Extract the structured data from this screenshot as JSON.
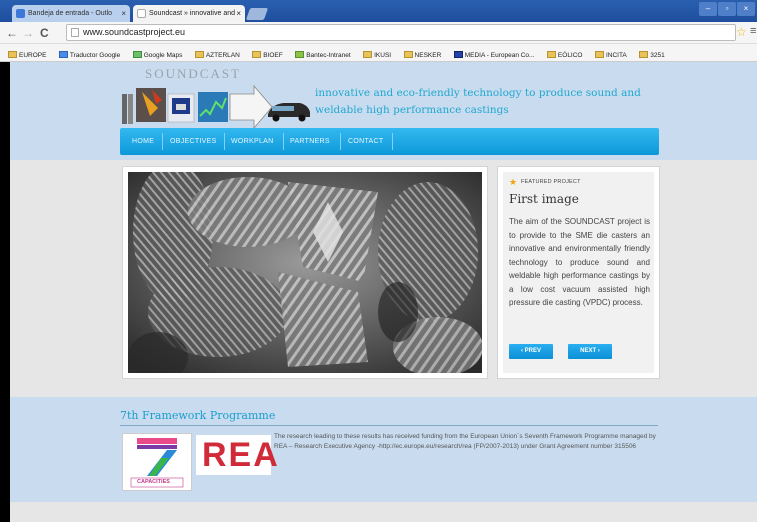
{
  "browser": {
    "tabs": [
      {
        "label": "Bandeja de entrada - Outlo",
        "close": "×"
      },
      {
        "label": "Soundcast » innovative and",
        "close": "×"
      }
    ],
    "window_controls": [
      "–",
      "▫",
      "×"
    ],
    "nav": {
      "back": "←",
      "forward": "→",
      "reload": "C"
    },
    "url": "www.soundcastproject.eu",
    "star": "☆",
    "menu": "≡",
    "bookmarks": [
      "EUROPE",
      "Traductor Google",
      "Google Maps",
      "AZTERLAN",
      "BIOEF",
      "Bantec-Intranet",
      "IKUSI",
      "NESKER",
      "MEDIA - European Co...",
      "EÓLICO",
      "INCITA",
      "3251"
    ]
  },
  "site": {
    "logo_text": "SOUNDCAST",
    "tagline": "innovative and eco-friendly technology to produce sound and weldable high performance castings",
    "nav": [
      "HOME",
      "OBJECTIVES",
      "WORKPLAN",
      "PARTNERS",
      "CONTACT"
    ]
  },
  "featured": {
    "label": "FEATURED PROJECT",
    "title": "First image",
    "body": "The aim of the SOUNDCAST project is to provide to the SME die casters an innovative and environmentally friendly technology to produce sound and weldable high performance castings by a low cost vacuum assisted high pressure die casting (VPDC) process.",
    "prev": "‹ PREV",
    "next": "NEXT ›"
  },
  "footer": {
    "title": "7th Framework Programme",
    "logo7_label": "CAPACITIES",
    "logo_rea": "REA",
    "text": "The research leading to these results has received funding from the European Union´s Seventh Framework Programme managed by REA – Research Executive Agency -http://ec.europe.eu/research/rea (FP/2007-2013) under Grant Agreement number 315506"
  },
  "colors": {
    "accent": "#21a7cf",
    "nav_bg": "#0c98d9",
    "header_bg": "#c9dcef"
  }
}
